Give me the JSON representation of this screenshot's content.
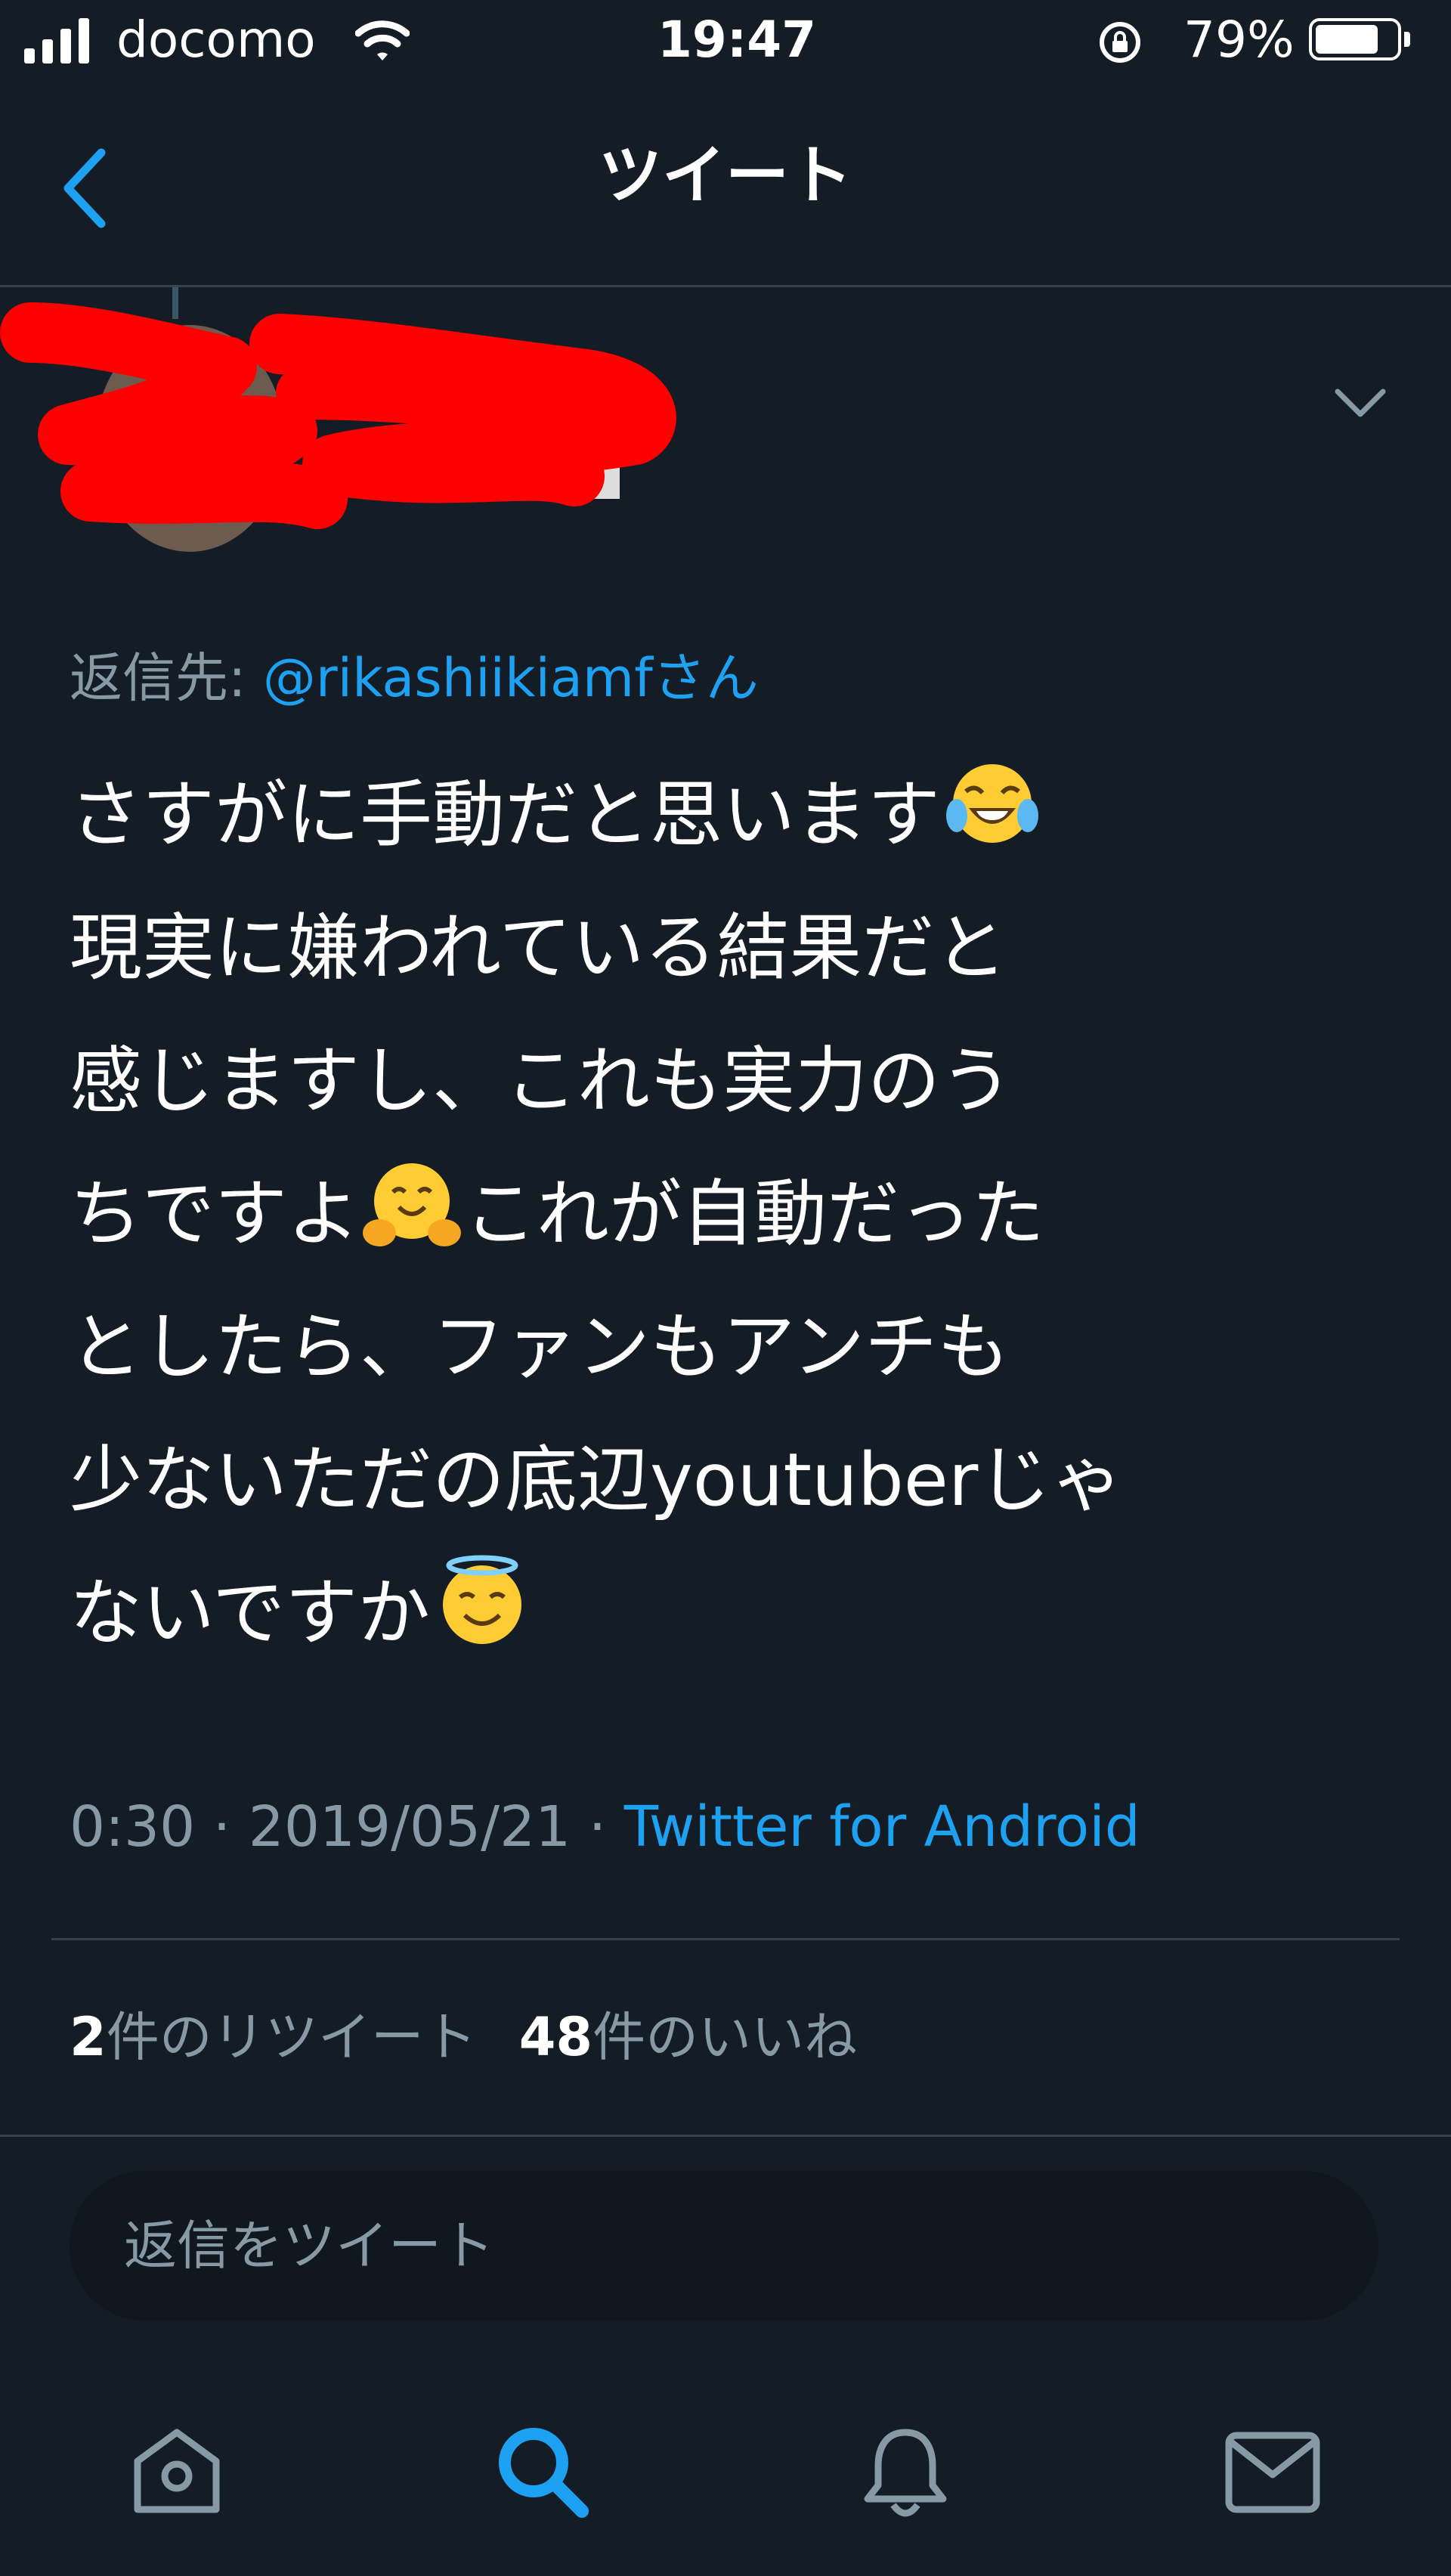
{
  "status_bar": {
    "carrier": "docomo",
    "time": "19:47",
    "battery_percent": "79%",
    "battery_level": 0.79
  },
  "header": {
    "title": "ツイート",
    "back_icon": "chevron-left-icon"
  },
  "tweet": {
    "reply_label": "返信先: ",
    "reply_to": "@rikashiikiamfさん",
    "text": {
      "line1": "さすがに手動だと思います",
      "line2": "現実に嫌われている結果だと",
      "line3": "感じますし、これも実力のう",
      "line4a": "ちですよ",
      "line4b": "これが自動だった",
      "line5": "としたら、ファンもアンチも",
      "line6": "少ないただの底辺youtuberじゃ",
      "line7": "ないですか"
    },
    "emojis": [
      "face-with-tears-of-joy",
      "hugging-face",
      "smiling-face-with-halo"
    ],
    "timestamp": "0:30 · 2019/05/21 · ",
    "source": "Twitter for Android",
    "retweet_count": "2",
    "retweet_label": "件のリツイート",
    "like_count": "48",
    "like_label": "件のいいね",
    "more_icon": "chevron-down-icon"
  },
  "reply": {
    "placeholder": "返信をツイート"
  },
  "tab_bar": {
    "items": [
      "home-icon",
      "search-icon",
      "notifications-icon",
      "messages-icon"
    ],
    "active": "search-icon"
  },
  "colors": {
    "background": "#141d26",
    "accent": "#1da1f2",
    "secondary_text": "#8899a6",
    "redaction": "#ff0000"
  }
}
